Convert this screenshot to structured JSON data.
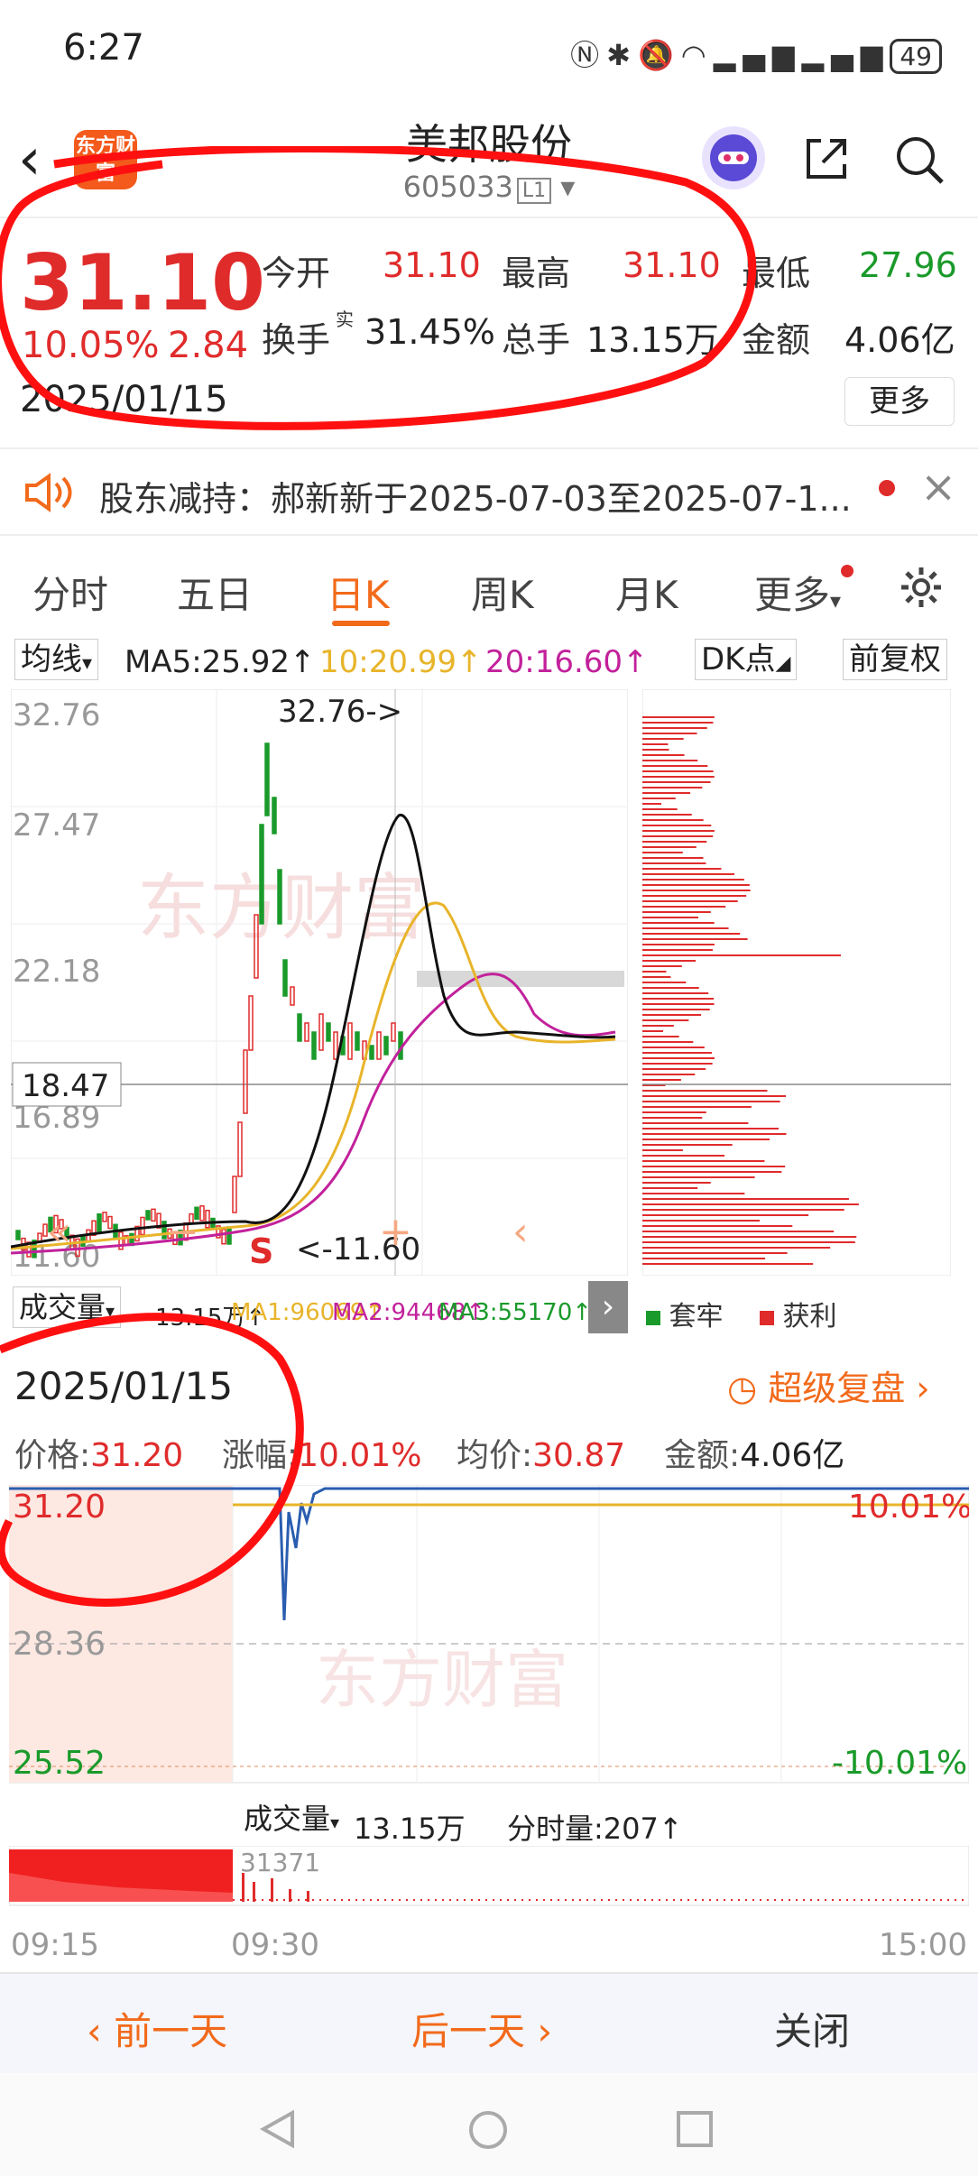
{
  "status": {
    "time": "6:27",
    "battery": "49"
  },
  "header": {
    "title": "美邦股份",
    "code": "605033",
    "market_badge": "L1",
    "logo_text": "东方财富"
  },
  "quote": {
    "price": "31.10",
    "change_pct": "10.05%",
    "change": "2.84",
    "date": "2025/01/15",
    "open_label": "今开",
    "open": "31.10",
    "high_label": "最高",
    "high": "31.10",
    "low_label": "最低",
    "low": "27.96",
    "turnover_label": "换手",
    "turnover_sup": "实",
    "turnover": "31.45%",
    "vol_label": "总手",
    "vol": "13.15万",
    "amount_label": "金额",
    "amount": "4.06亿",
    "more_button": "更多"
  },
  "notice": {
    "text": "股东减持：郝新新于2025-07-03至2025-07-1..."
  },
  "tabs": [
    "分时",
    "五日",
    "日K",
    "周K",
    "月K",
    "更多"
  ],
  "active_tab": 2,
  "indicators": {
    "ma_select": "均线",
    "ma5": "MA5:25.92↑",
    "ma10": "10:20.99↑",
    "ma20": "20:16.60↑",
    "dk_select": "DK点",
    "adjust": "前复权"
  },
  "kchart": {
    "y_labels": [
      "32.76",
      "27.47",
      "22.18",
      "16.89",
      "11.60"
    ],
    "crosshair_price": "18.47",
    "max_note": "32.76->",
    "min_note": "<-11.60",
    "s_marker": "S",
    "watermark": "东方财富"
  },
  "volume_row": {
    "label": "成交量",
    "vol": "13.15万↑",
    "ma1": "MA1:96069↑",
    "ma2": "MA2:94468↑",
    "ma3": "MA3:55170↑",
    "legend_trapped": "套牢",
    "legend_profit": "获利"
  },
  "replay": {
    "date": "2025/01/15",
    "replay_link": "超级复盘",
    "price_label": "价格:",
    "price": "31.20",
    "chg_label": "涨幅:",
    "chg": "10.01%",
    "avg_label": "均价:",
    "avg": "30.87",
    "amt_label": "金额:",
    "amt": "4.06亿",
    "top_price": "31.20",
    "top_pct": "10.01%",
    "mid_price": "28.36",
    "bottom_price": "25.52",
    "bottom_pct": "-10.01%",
    "vol_select": "成交量",
    "vol": "13.15万",
    "tick_vol": "分时量:207↑",
    "peak_vol": "31371",
    "times": [
      "09:15",
      "09:30",
      "15:00"
    ]
  },
  "footer": {
    "prev": "前一天",
    "next": "后一天",
    "close": "关闭"
  },
  "colors": {
    "up": "#e02b2b",
    "down": "#1a9a2a",
    "accent": "#f26a1b",
    "ma5": "#111111",
    "ma10": "#e8b42a",
    "ma20": "#c2219b"
  }
}
